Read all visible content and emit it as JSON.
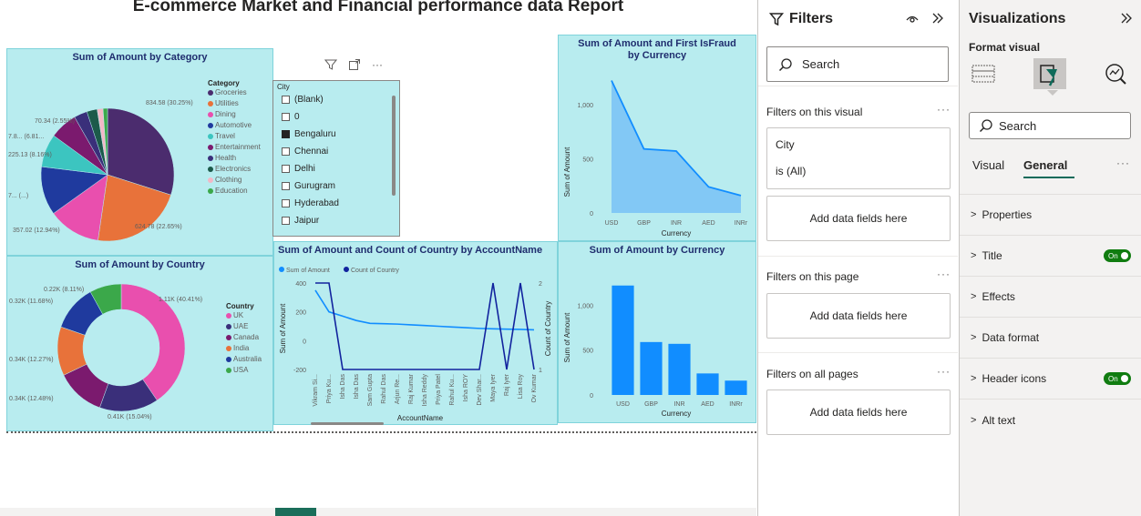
{
  "report": {
    "title": "E-commerce Market and Financial performance data Report"
  },
  "visual_header": {
    "filter_icon": "filter-icon",
    "focus_icon": "focus-mode-icon",
    "more": "···"
  },
  "category_pie": {
    "title": "Sum of Amount by Category",
    "legend_title": "Category",
    "labels": [
      "70.34 (2.55%)",
      "7.8... (6.81...",
      "225.13 (8.16%)",
      "7... (...)",
      "357.02 (12.94%)",
      "834.58 (30.25%)",
      "624.78 (22.65%)"
    ]
  },
  "country_donut": {
    "title": "Sum of Amount by Country",
    "legend_title": "Country",
    "labels": [
      "0.22K (8.11%)",
      "0.32K (11.68%)",
      "0.34K (12.27%)",
      "0.34K (12.48%)",
      "1.11K (40.41%)",
      "0.41K (15.04%)"
    ]
  },
  "slicer": {
    "header": "City",
    "items": [
      {
        "label": "(Blank)",
        "checked": false
      },
      {
        "label": "0",
        "checked": false
      },
      {
        "label": "Bengaluru",
        "checked": true
      },
      {
        "label": "Chennai",
        "checked": false
      },
      {
        "label": "Delhi",
        "checked": false
      },
      {
        "label": "Gurugram",
        "checked": false
      },
      {
        "label": "Hyderabad",
        "checked": false
      },
      {
        "label": "Jaipur",
        "checked": false
      }
    ]
  },
  "chart_data": [
    {
      "type": "pie",
      "title": "Sum of Amount by Category",
      "legend_title": "Category",
      "categories": [
        "Groceries",
        "Utilities",
        "Dining",
        "Automotive",
        "Travel",
        "Entertainment",
        "Health",
        "Electronics",
        "Clothing",
        "Education"
      ],
      "values": [
        834.58,
        624.78,
        357.02,
        330,
        225.13,
        187.9,
        90,
        70.34,
        40,
        30
      ],
      "colors": [
        "#4b2c6e",
        "#e8723a",
        "#e94fae",
        "#1f3a9e",
        "#3cc5c0",
        "#7b1a6e",
        "#3a2f7a",
        "#1c5a4a",
        "#f2b8c6",
        "#3ba84a"
      ]
    },
    {
      "type": "pie",
      "subtype": "donut",
      "title": "Sum of Amount by Country",
      "legend_title": "Country",
      "categories": [
        "UK",
        "UAE",
        "Canada",
        "India",
        "Australia",
        "USA"
      ],
      "values": [
        1.11,
        0.41,
        0.34,
        0.34,
        0.32,
        0.22
      ],
      "colors": [
        "#e94fae",
        "#3a2f7a",
        "#7b1a6e",
        "#e8723a",
        "#1f3a9e",
        "#3ba84a"
      ]
    },
    {
      "type": "line",
      "title": "Sum of Amount and Count of Country by AccountName",
      "xlabel": "AccountName",
      "ylabel": "Sum of Amount",
      "y2label": "Count of Country",
      "categories": [
        "Vikram Si...",
        "Priya Ku...",
        "Isha Das",
        "Isha Das",
        "Sam Gupta",
        "Rahul Das",
        "Arjun Re...",
        "Raj Kumar",
        "Isha Reddy",
        "Priya Patel",
        "Rahul Ku...",
        "Isha ROY",
        "Dev Shar...",
        "Maya Iyer",
        "Raj Iyer",
        "Lisa Roy",
        "Ov Kumar"
      ],
      "ylim": [
        -200,
        400
      ],
      "y2lim": [
        1,
        2
      ],
      "series": [
        {
          "name": "Sum of Amount",
          "color": "#118dff",
          "values": [
            350,
            200,
            170,
            140,
            120,
            118,
            115,
            110,
            105,
            100,
            95,
            90,
            85,
            82,
            80,
            78,
            75
          ]
        },
        {
          "name": "Count of Country",
          "color": "#12239e",
          "values": [
            2,
            2,
            1,
            1,
            1,
            1,
            1,
            1,
            1,
            1,
            1,
            1,
            1,
            2,
            1,
            2,
            1
          ],
          "axis": "y2"
        }
      ],
      "yticks": [
        "400",
        "200",
        "0",
        "-200"
      ],
      "y2ticks": [
        "2",
        "1"
      ]
    },
    {
      "type": "area",
      "title": "Sum of Amount and First IsFraud by Currency",
      "xlabel": "Currency",
      "ylabel": "Sum of Amount",
      "categories": [
        "USD",
        "GBP",
        "INR",
        "AED",
        "INRr"
      ],
      "values": [
        1220,
        590,
        570,
        240,
        160
      ],
      "ylim": [
        0,
        1300
      ],
      "yticks": [
        "1,000",
        "500",
        "0"
      ],
      "color": "#118dff"
    },
    {
      "type": "bar",
      "title": "Sum of Amount by Currency",
      "xlabel": "Currency",
      "ylabel": "Sum of Amount",
      "categories": [
        "USD",
        "GBP",
        "INR",
        "AED",
        "INRr"
      ],
      "values": [
        1220,
        590,
        570,
        240,
        160
      ],
      "ylim": [
        0,
        1400
      ],
      "yticks": [
        "1,000",
        "500",
        "0"
      ],
      "color": "#118dff"
    }
  ],
  "filters": {
    "header": "Filters",
    "search_placeholder": "Search",
    "on_visual": "Filters on this visual",
    "city_field": "City",
    "city_value": "is (All)",
    "add_fields": "Add data fields here",
    "on_page": "Filters on this page",
    "on_all": "Filters on all pages",
    "more": "···"
  },
  "visualizations": {
    "header": "Visualizations",
    "format_visual": "Format visual",
    "search_placeholder": "Search",
    "tab_visual": "Visual",
    "tab_general": "General",
    "more": "···",
    "sections": [
      "Properties",
      "Title",
      "Effects",
      "Data format",
      "Header icons",
      "Alt text"
    ],
    "toggle_on": "On"
  }
}
